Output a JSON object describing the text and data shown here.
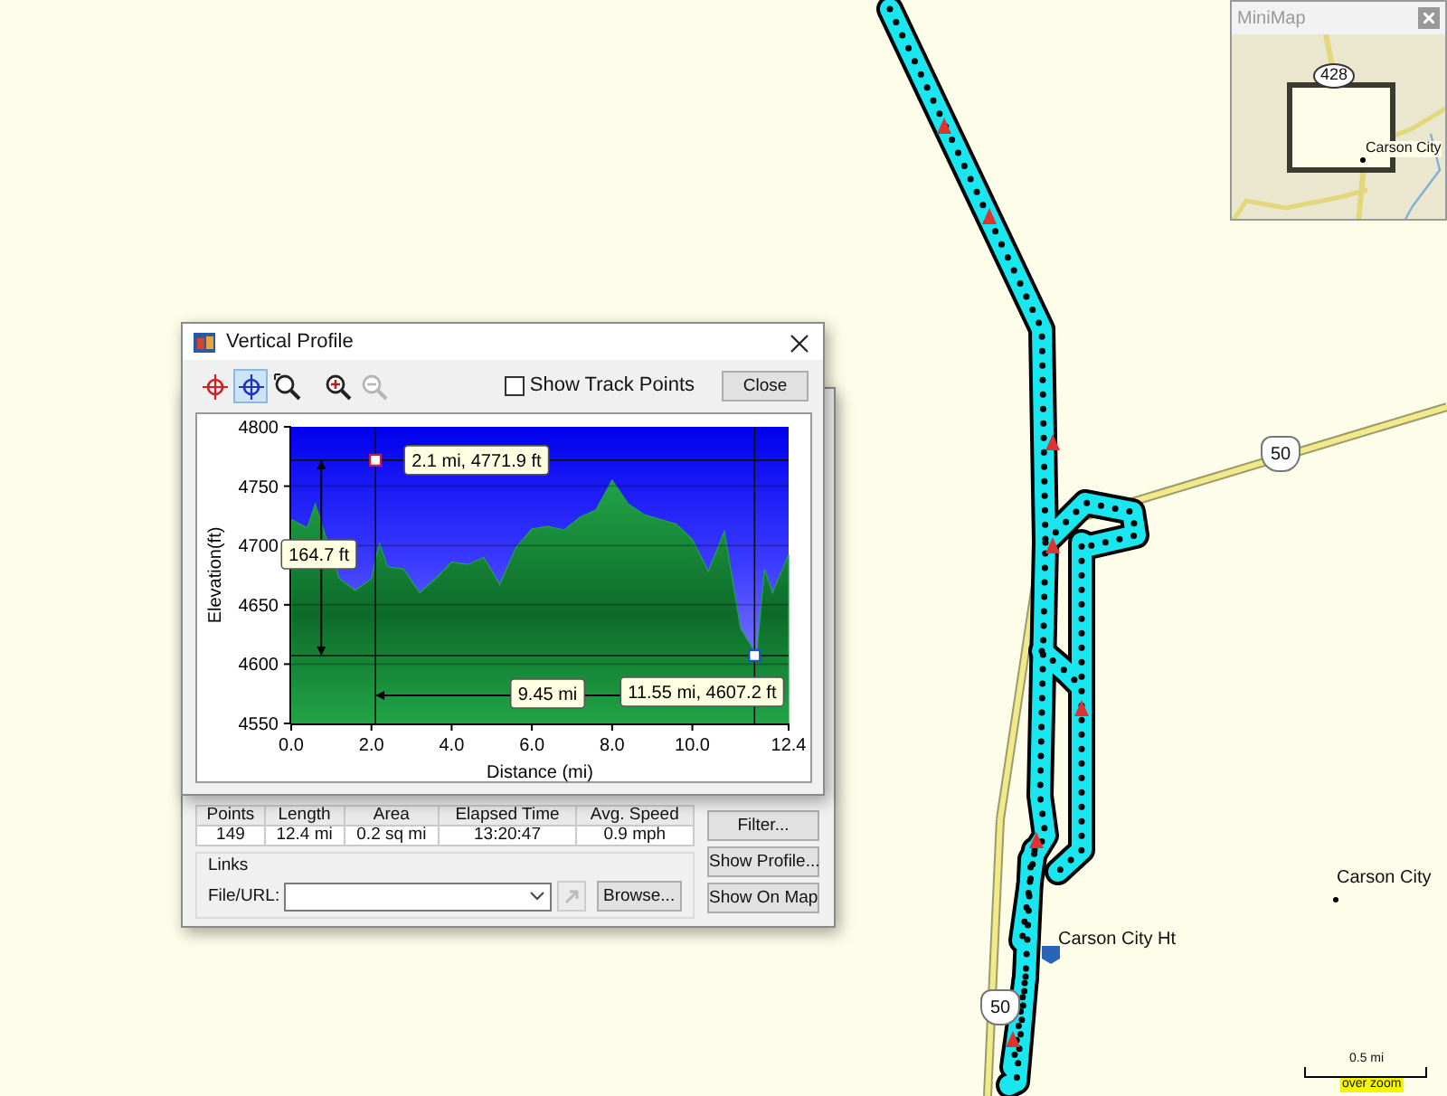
{
  "map": {
    "labels": [
      {
        "kind": "shield",
        "text": "50"
      },
      {
        "kind": "shield",
        "text": "50"
      },
      {
        "kind": "city",
        "text": "Carson City"
      },
      {
        "kind": "waypoint",
        "text": "Carson City Ht"
      }
    ],
    "scale": {
      "distance": "0.5 mi",
      "note": "over zoom"
    }
  },
  "minimap": {
    "title": "MiniMap",
    "labels": [
      {
        "kind": "shield",
        "text": "428"
      },
      {
        "kind": "city",
        "text": "Carson City"
      }
    ]
  },
  "track_dialog": {
    "stats": {
      "columns": [
        "Points",
        "Length",
        "Area",
        "Elapsed Time",
        "Avg. Speed"
      ],
      "values": [
        "149",
        "12.4 mi",
        "0.2 sq mi",
        "13:20:47",
        "0.9 mph"
      ]
    },
    "links": {
      "title": "Links",
      "label": "File/URL:",
      "browse": "Browse..."
    },
    "buttons": [
      "Filter...",
      "Show Profile...",
      "Show On Map"
    ]
  },
  "profile_window": {
    "title": "Vertical Profile",
    "tools": [
      {
        "kind": "red-crosshair",
        "selected": false,
        "disabled": false
      },
      {
        "kind": "blue-crosshair",
        "selected": true,
        "disabled": false
      },
      {
        "kind": "zoom-area",
        "selected": false,
        "disabled": false
      },
      {
        "kind": "zoom-in",
        "selected": false,
        "disabled": false
      },
      {
        "kind": "zoom-out",
        "selected": false,
        "disabled": true
      }
    ],
    "show_track_points": {
      "label": "Show Track Points",
      "checked": false
    },
    "close": "Close",
    "chart_data": {
      "type": "area",
      "xlabel": "Distance (mi)",
      "ylabel": "Elevation(ft)",
      "x": [
        0,
        0.4,
        0.6,
        1.2,
        1.6,
        2.0,
        2.2,
        2.4,
        2.8,
        3.2,
        3.6,
        4.0,
        4.4,
        4.8,
        5.2,
        5.6,
        6.0,
        6.4,
        6.8,
        7.2,
        7.6,
        8.0,
        8.4,
        8.8,
        9.2,
        9.6,
        10.0,
        10.4,
        10.8,
        11.2,
        11.6,
        11.8,
        12.0,
        12.4
      ],
      "series": [
        {
          "color": "#22a447",
          "values": [
            4722,
            4715,
            4735,
            4672,
            4662,
            4672,
            4702,
            4682,
            4680,
            4660,
            4672,
            4686,
            4684,
            4690,
            4667,
            4698,
            4714,
            4716,
            4713,
            4724,
            4730,
            4755,
            4735,
            4726,
            4722,
            4718,
            4705,
            4678,
            4712,
            4630,
            4608,
            4680,
            4660,
            4692
          ]
        }
      ],
      "xlim": [
        0,
        12.4
      ],
      "ylim": [
        4550,
        4800
      ],
      "grid": true,
      "xticks": [
        {
          "value": 0,
          "label": "0.0"
        },
        {
          "value": 2,
          "label": "2.0"
        },
        {
          "value": 4,
          "label": "4.0"
        },
        {
          "value": 6,
          "label": "6.0"
        },
        {
          "value": 8,
          "label": "8.0"
        },
        {
          "value": 10,
          "label": "10.0"
        },
        {
          "value": 12.4,
          "label": "12.4"
        }
      ],
      "yticks": [
        4550,
        4600,
        4650,
        4700,
        4750,
        4800
      ],
      "annotations": [
        {
          "text": "2.1 mi, 4771.9 ft",
          "x": 2.1,
          "y": 4771.9
        },
        {
          "text": "164.7 ft",
          "x": 0.75,
          "y": 4691
        },
        {
          "text": "9.45 mi"
        },
        {
          "text": "11.55 mi, 4607.2 ft",
          "x": 11.55,
          "y": 4607.2
        }
      ]
    }
  }
}
